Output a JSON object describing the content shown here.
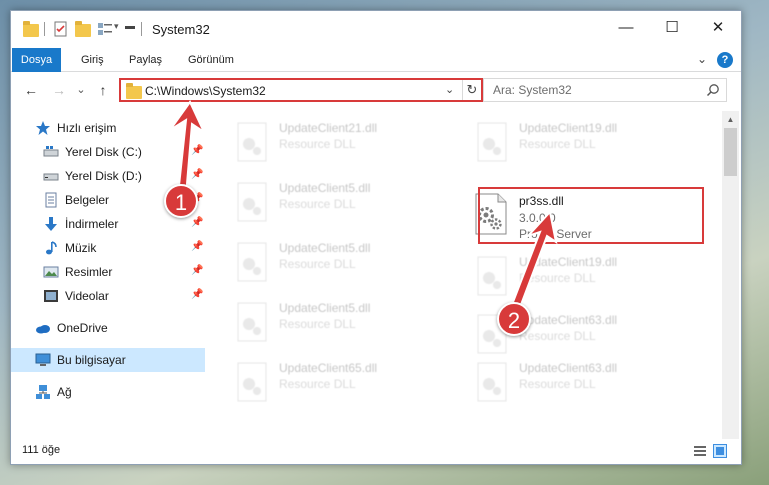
{
  "window": {
    "title": "System32",
    "controls": {
      "minimize": "—",
      "maximize": "☐",
      "close": "✕"
    }
  },
  "ribbon": {
    "tabs": [
      {
        "label": "Dosya"
      },
      {
        "label": "Giriş"
      },
      {
        "label": "Paylaş"
      },
      {
        "label": "Görünüm"
      }
    ],
    "collapse_glyph": "⌄",
    "help_glyph": "?"
  },
  "nav": {
    "back": "←",
    "forward": "→",
    "recent": "⌄",
    "up": "↑",
    "address": "C:\\Windows\\System32",
    "address_dropdown": "⌄",
    "refresh": "↻",
    "search_placeholder": "Ara: System32"
  },
  "sidebar": {
    "items": [
      {
        "label": "Hızlı erişim",
        "icon": "star-icon"
      },
      {
        "label": "Yerel Disk (C:)",
        "icon": "drive-icon",
        "pinned": true
      },
      {
        "label": "Yerel Disk (D:)",
        "icon": "drive-icon",
        "pinned": true
      },
      {
        "label": "Belgeler",
        "icon": "documents-icon",
        "pinned": true
      },
      {
        "label": "İndirmeler",
        "icon": "download-icon",
        "pinned": true
      },
      {
        "label": "Müzik",
        "icon": "music-icon",
        "pinned": true
      },
      {
        "label": "Resimler",
        "icon": "pictures-icon",
        "pinned": true
      },
      {
        "label": "Videolar",
        "icon": "video-icon",
        "pinned": true
      },
      {
        "label": "OneDrive",
        "icon": "cloud-icon"
      },
      {
        "label": "Bu bilgisayar",
        "icon": "computer-icon",
        "selected": true
      },
      {
        "label": "Ağ",
        "icon": "network-icon"
      }
    ]
  },
  "files": {
    "left": [
      {
        "name": "UpdateClient21.dll",
        "type": "Resource DLL"
      },
      {
        "name": "UpdateClient5.dll",
        "type": "Resource DLL"
      },
      {
        "name": "UpdateClient5.dll",
        "type": "Resource DLL"
      },
      {
        "name": "UpdateClient5.dll",
        "type": "Resource DLL"
      },
      {
        "name": "UpdateClient65.dll",
        "type": "Resource DLL"
      }
    ],
    "right": [
      {
        "name": "UpdateClient19.dll",
        "type": "Resource DLL"
      },
      {
        "name": "pr3ss.dll",
        "version": "3.0.0.0",
        "type": "Profile Server",
        "highlighted": true
      },
      {
        "name": "UpdateClient19.dll",
        "type": "Resource DLL"
      },
      {
        "name": "UpdateClient63.dll",
        "type": "Resource DLL"
      },
      {
        "name": "UpdateClient63.dll",
        "type": "Resource DLL"
      }
    ]
  },
  "status": {
    "count": "111 öğe"
  },
  "callouts": {
    "one": "1",
    "two": "2"
  },
  "colors": {
    "accent": "#1979ca",
    "highlight": "#d83a3a",
    "selection": "#cce8ff"
  }
}
